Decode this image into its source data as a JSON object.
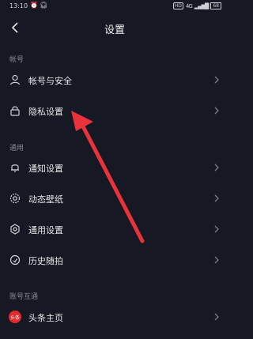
{
  "status": {
    "time": "13:10",
    "hd": "HD",
    "signal": "4G",
    "battery": "68"
  },
  "header": {
    "title": "设置"
  },
  "sections": [
    {
      "label": "帐号",
      "items": [
        {
          "label": "帐号与安全"
        },
        {
          "label": "隐私设置"
        }
      ]
    },
    {
      "label": "通用",
      "items": [
        {
          "label": "通知设置"
        },
        {
          "label": "动态壁纸"
        },
        {
          "label": "通用设置"
        },
        {
          "label": "历史随拍"
        }
      ]
    },
    {
      "label": "账号互通",
      "items": [
        {
          "label": "头条主页",
          "badge": "头条"
        }
      ]
    }
  ],
  "colors": {
    "background": "#161823",
    "arrow": "#e8333a",
    "badge": "#e22a2a"
  }
}
